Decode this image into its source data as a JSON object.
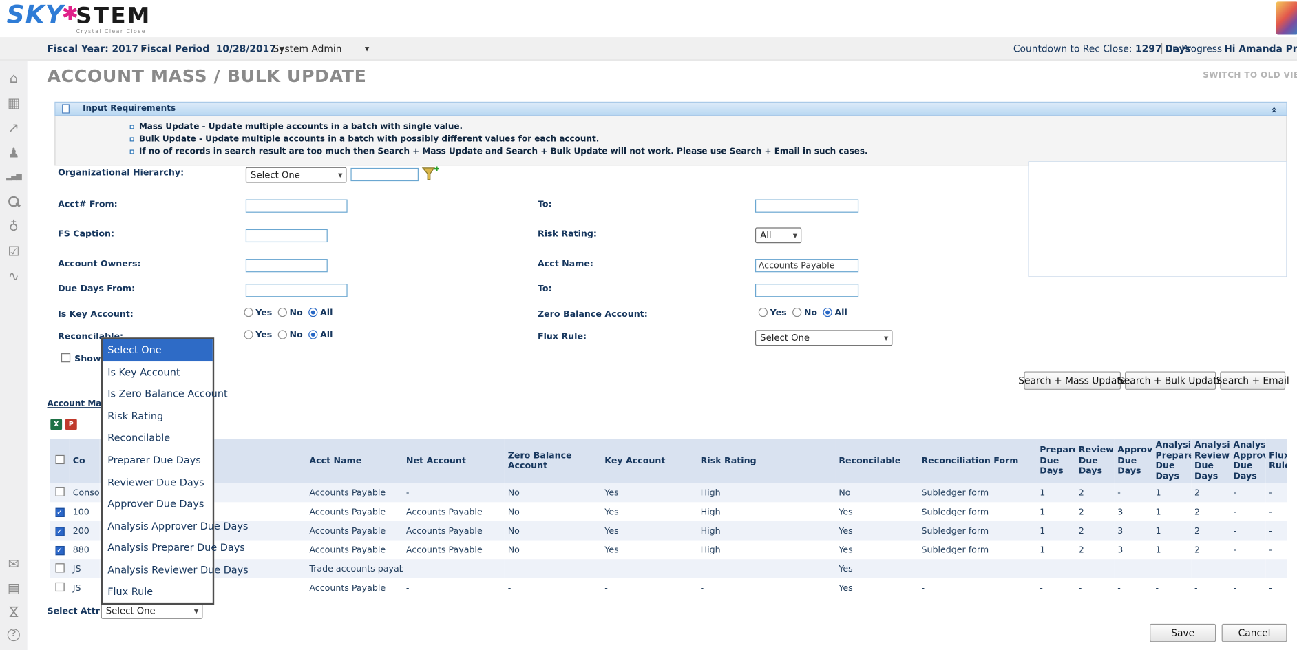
{
  "icons": {
    "caret_down": "▼",
    "collapse_up": "«",
    "check": "✓",
    "star": "✱"
  },
  "brand": {
    "sky": "SKY",
    "stem": "STEM",
    "tagline": "Crystal Clear Close"
  },
  "toolbar": {
    "fiscal_year_label": "Fiscal Year:",
    "fiscal_year_value": "2017",
    "fiscal_period_label": "Fiscal Period",
    "fiscal_period_value": "10/28/2017",
    "role_value": "System Admin",
    "countdown_label": "Countdown to Rec Close:",
    "countdown_value": "1297 Days",
    "status": "In Progress",
    "user_greeting": "Hi Amanda Prep"
  },
  "page": {
    "title": "ACCOUNT MASS / BULK UPDATE",
    "switch_view": "SWITCH TO OLD VIE"
  },
  "sidebar": {
    "top_icons": [
      {
        "name": "home-icon",
        "glyph": "⌂"
      },
      {
        "name": "dashboard-icon",
        "glyph": "▦"
      },
      {
        "name": "export-icon",
        "glyph": "↗"
      },
      {
        "name": "users-icon",
        "glyph": "♟"
      },
      {
        "name": "bar-chart-icon",
        "glyph": "▂▄▆",
        "cls": "bars"
      },
      {
        "name": "search-icon",
        "glyph": "",
        "cls": "mag"
      },
      {
        "name": "globe-icon",
        "glyph": "♁"
      },
      {
        "name": "checklist-icon",
        "glyph": "☑"
      },
      {
        "name": "trend-icon",
        "glyph": "∿"
      }
    ],
    "bottom_icons": [
      {
        "name": "mail-icon",
        "glyph": "✉"
      },
      {
        "name": "notes-icon",
        "glyph": "▤"
      },
      {
        "name": "hourglass-icon",
        "glyph": "⋈",
        "cls": "rot"
      },
      {
        "name": "help-icon",
        "glyph": "?",
        "cls": "circle"
      }
    ]
  },
  "info_panel": {
    "title": "Input Requirements",
    "bullets": [
      "Mass Update - Update multiple accounts in a batch with single value.",
      "Bulk Update - Update multiple accounts in a batch with possibly different values for each account.",
      "If no of records in search result are too much then Search + Mass Update and Search + Bulk Update will not work. Please use Search + Email in such cases."
    ]
  },
  "search_form": {
    "org_hierarchy_label": "Organizational Hierarchy:",
    "org_hierarchy_value": "Select One",
    "acct_from_label": "Acct# From:",
    "to_label": "To:",
    "fs_caption_label": "FS Caption:",
    "risk_rating_label": "Risk Rating:",
    "risk_rating_value": "All",
    "account_owners_label": "Account Owners:",
    "acct_name_label": "Acct Name:",
    "acct_name_value": "Accounts Payable",
    "due_days_from_label": "Due Days From:",
    "is_key_account_label": "Is Key Account:",
    "is_key_account_value": "All",
    "zero_balance_label": "Zero Balance Account:",
    "zero_balance_value": "All",
    "reconcilable_label": "Reconcilable:",
    "reconcilable_value": "All",
    "flux_rule_label": "Flux Rule:",
    "flux_rule_value": "Select One",
    "show_on_label": "Show On",
    "radio_options": [
      "Yes",
      "No",
      "All"
    ]
  },
  "attribute_dropdown": {
    "selected_index": 0,
    "items": [
      "Select One",
      "Is Key Account",
      "Is Zero Balance Account",
      "Risk Rating",
      "Reconcilable",
      "Preparer Due Days",
      "Reviewer Due Days",
      "Approver Due Days",
      "Analysis Approver Due Days",
      "Analysis Preparer Due Days",
      "Analysis Reviewer Due Days",
      "Flux Rule"
    ]
  },
  "actions": {
    "search_mass_update": "Search + Mass Update",
    "search_bulk_update": "Search + Bulk Update",
    "search_email": "Search + Email",
    "save": "Save",
    "cancel": "Cancel"
  },
  "results": {
    "link_label": "Account Mass Up",
    "select_attribute_label": "Select Attribute:",
    "select_attribute_value": "Select One",
    "columns": [
      "Co",
      "",
      "Acct Name",
      "Net Account",
      "Zero Balance Account",
      "Key Account",
      "Risk Rating",
      "Reconcilable",
      "Reconciliation Form",
      "Preparer Due Days",
      "Reviewer Due Days",
      "Approver Due Days",
      "Analysis Preparer Due Days",
      "Analysis Reviewer Due Days",
      "Analysis Approver Due Days",
      "Flux Rule"
    ],
    "rows": [
      {
        "checked": false,
        "cells": [
          "Consolid",
          "",
          "Accounts Payable",
          "-",
          "No",
          "Yes",
          "High",
          "No",
          "Subledger form",
          "1",
          "2",
          "-",
          "1",
          "2",
          "-",
          "-"
        ]
      },
      {
        "checked": true,
        "cells": [
          "100",
          "",
          "Accounts Payable",
          "Accounts Payable",
          "No",
          "Yes",
          "High",
          "Yes",
          "Subledger form",
          "1",
          "2",
          "3",
          "1",
          "2",
          "-",
          "-"
        ]
      },
      {
        "checked": true,
        "cells": [
          "200",
          "",
          "Accounts Payable",
          "Accounts Payable",
          "No",
          "Yes",
          "High",
          "Yes",
          "Subledger form",
          "1",
          "2",
          "3",
          "1",
          "2",
          "-",
          "-"
        ]
      },
      {
        "checked": true,
        "cells": [
          "880",
          "",
          "Accounts Payable",
          "Accounts Payable",
          "No",
          "Yes",
          "High",
          "Yes",
          "Subledger form",
          "1",
          "2",
          "3",
          "1",
          "2",
          "-",
          "-"
        ]
      },
      {
        "checked": false,
        "cells": [
          "JS",
          "",
          "Trade accounts payable",
          "-",
          "-",
          "-",
          "-",
          "Yes",
          "-",
          "-",
          "-",
          "-",
          "-",
          "-",
          "-",
          "-"
        ]
      },
      {
        "checked": false,
        "cells": [
          "JS",
          "",
          "Accounts Payable",
          "-",
          "-",
          "-",
          "-",
          "Yes",
          "-",
          "-",
          "-",
          "-",
          "-",
          "-",
          "-",
          "-"
        ]
      }
    ]
  }
}
